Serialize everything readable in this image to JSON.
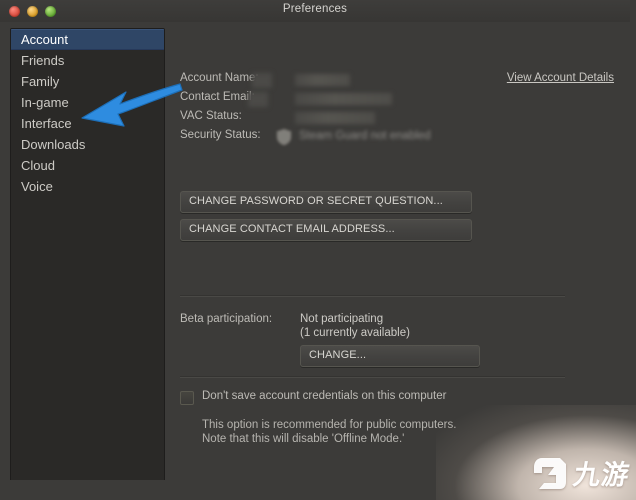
{
  "window": {
    "title": "Preferences",
    "controls": [
      "close-button",
      "minimize-button",
      "zoom-button"
    ]
  },
  "sidebar": {
    "items": [
      {
        "label": "Account",
        "selected": true
      },
      {
        "label": "Friends",
        "selected": false
      },
      {
        "label": "Family",
        "selected": false
      },
      {
        "label": "In-game",
        "selected": false
      },
      {
        "label": "Interface",
        "selected": false
      },
      {
        "label": "Downloads",
        "selected": false
      },
      {
        "label": "Cloud",
        "selected": false
      },
      {
        "label": "Voice",
        "selected": false
      }
    ]
  },
  "main": {
    "info_rows": [
      {
        "label": "Account Name:",
        "value": "",
        "redacted": true
      },
      {
        "label": "Contact Email:",
        "value": "",
        "redacted": true
      },
      {
        "label": "VAC Status:",
        "value": "",
        "redacted": true
      },
      {
        "label": "Security Status:",
        "value": "Steam Guard not enabled",
        "redacted": true
      }
    ],
    "view_account_details": "View Account Details",
    "buttons": {
      "change_password": "CHANGE PASSWORD OR SECRET QUESTION...",
      "change_email": "CHANGE CONTACT EMAIL ADDRESS...",
      "change_beta": "CHANGE..."
    },
    "beta": {
      "label": "Beta participation:",
      "value": "Not participating",
      "available": "(1 currently available)"
    },
    "credentials": {
      "checkbox_label": "Don't save account credentials on this computer",
      "checked": false,
      "help_line_1": "This option is recommended for public computers.",
      "help_line_2": "Note that this will disable 'Offline Mode.'"
    }
  },
  "annotations": {
    "arrow_color": "#2e8ce0",
    "arrow_target": "Interface"
  },
  "watermark": {
    "text": "九游"
  },
  "colors": {
    "selection_blue": "#2f4666",
    "window_bg": "#3c3b39",
    "sidebar_bg": "#2a2927",
    "arrow_blue": "#2e8ce0"
  }
}
